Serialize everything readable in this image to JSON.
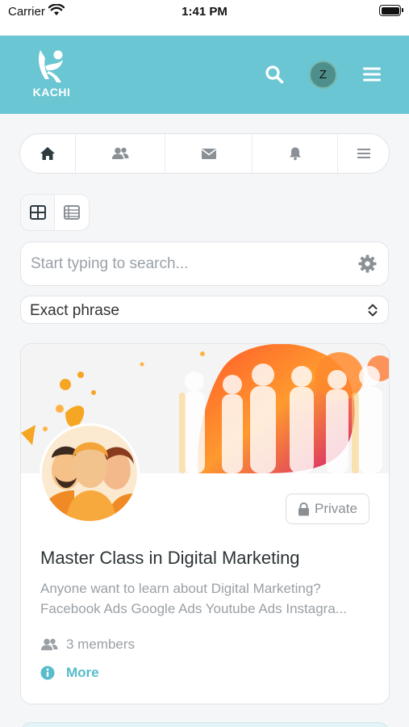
{
  "status_bar": {
    "carrier": "Carrier",
    "time": "1:41 PM"
  },
  "app_bar": {
    "logo_text": "KACHI",
    "avatar_initial": "Z",
    "background": "#6ac6d3",
    "icons": [
      "search-icon",
      "hamburger-menu-icon"
    ]
  },
  "nav_tabs": [
    {
      "icon": "home-icon",
      "active": true
    },
    {
      "icon": "users-icon"
    },
    {
      "icon": "envelope-icon"
    },
    {
      "icon": "bell-icon"
    },
    {
      "icon": "list-menu-icon"
    }
  ],
  "view_toggle": {
    "options": [
      "grid-view-icon",
      "list-view-icon"
    ],
    "selected": "grid-view-icon"
  },
  "search": {
    "placeholder": "Start typing to search...",
    "value": ""
  },
  "filter": {
    "selected": "Exact phrase"
  },
  "group_card": {
    "privacy_label": "Private",
    "title": "Master Class in Digital Marketing",
    "description_line1": "Anyone want to learn about Digital Marketing?",
    "description_line2": "Facebook Ads Google Ads Youtube Ads Instagra...",
    "members_label": "3 members",
    "more_label": "More",
    "accent": "#57bccb"
  }
}
